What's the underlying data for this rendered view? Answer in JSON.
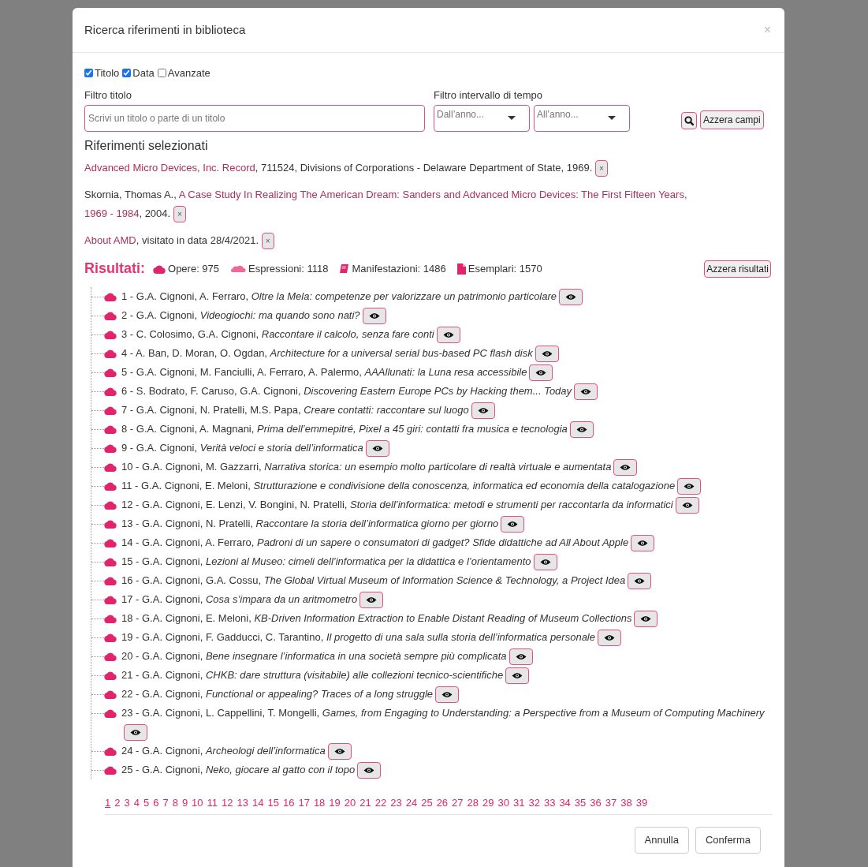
{
  "dialog": {
    "title": "Ricerca riferimenti in biblioteca",
    "close": "×"
  },
  "filters": [
    {
      "label": "Titolo",
      "checked": true
    },
    {
      "label": "Data",
      "checked": true
    },
    {
      "label": "Avanzate",
      "checked": false
    }
  ],
  "title_filter": {
    "label": "Filtro titolo",
    "placeholder": "Scrivi un titolo o parte di un titolo"
  },
  "time_filter": {
    "label": "Filtro intervallo di tempo",
    "from_placeholder": "Dall’anno...",
    "to_placeholder": "All’anno..."
  },
  "reset_fields": "Azzera campi",
  "selected_heading": "Riferimenti selezionati",
  "selected_refs": [
    {
      "segments": [
        {
          "kind": "link",
          "text": "Advanced Micro Devices, Inc. Record"
        },
        {
          "kind": "text",
          "text": ", 711524, Divisions of Corporations - Delaware Department of State, 1969."
        }
      ],
      "remove": "×"
    },
    {
      "segments": [
        {
          "kind": "text",
          "text": "Skornia, Thomas A.,"
        },
        {
          "kind": "link",
          "text": "A Case Study In Realizing The American Dream: Sanders and Advanced Micro Devices: The First Fifteen Years,"
        },
        {
          "kind": "link",
          "text": "1969 - 1984"
        },
        {
          "kind": "text",
          "text": ", 2004."
        }
      ],
      "remove": "×"
    },
    {
      "segments": [
        {
          "kind": "link",
          "text": "About AMD"
        },
        {
          "kind": "text",
          "text": ", visitato in data 28/4/2021."
        }
      ],
      "remove": "×"
    }
  ],
  "results": {
    "label": "Risultati:",
    "counts": [
      {
        "kind": "works",
        "text": "Opere: 975"
      },
      {
        "kind": "expressions",
        "text": "Espressioni: 1118"
      },
      {
        "kind": "manifestations",
        "text": "Manifestazioni: 1486"
      },
      {
        "kind": "items",
        "text": "Esemplari: 1570"
      }
    ],
    "reset": "Azzera risultati"
  },
  "result_rows": [
    {
      "prefix": "1 - G.A. Cignoni, A. Ferraro,",
      "title": "Oltre la Mela: competenze per valorizzare un patrimonio particolare"
    },
    {
      "prefix": "2 - G.A. Cignoni,",
      "title": "Videogiochi: ma quando sono nati?"
    },
    {
      "prefix": "3 - C. Colosimo, G.A. Cignoni,",
      "title": "Raccontare il calcolo, senza fare conti"
    },
    {
      "prefix": "4 - A. Ban, D. Moran, O. Ogdan,",
      "title": "Architecture for a universal serial bus-based PC flash disk"
    },
    {
      "prefix": "5 - G.A. Cignoni, M. Fanciulli, A. Ferraro, A. Palermo,",
      "title": "AAAllunati: la Luna resa accessibile"
    },
    {
      "prefix": "6 - S. Bodrato, F. Caruso, G.A. Cignoni,",
      "title": "Discovering Eastern Europe PCs by Hacking them... Today"
    },
    {
      "prefix": "7 - G.A. Cignoni, N. Pratelli, M.S. Papa,",
      "title": "Creare contatti: raccontare sul luogo"
    },
    {
      "prefix": "8 - G.A. Cignoni, A. Magnani,",
      "title": "Prima dell’emmepitré, Pixel a 45 giri: contatti fra musica e tecnologia"
    },
    {
      "prefix": "9 - G.A. Cignoni,",
      "title": "Verità veloci e storia dell’informatica"
    },
    {
      "prefix": "10 - G.A. Cignoni, M. Gazzarri,",
      "title": "Narrativa storica: un esempio molto particolare di realtà virtuale e aumentata"
    },
    {
      "prefix": "11 - G.A. Cignoni, E. Meloni,",
      "title": "Strutturazione e condivisione della conoscenza, informatica ed economia della catalogazione"
    },
    {
      "prefix": "12 - G.A. Cignoni, E. Lenzi, V. Bongini, N. Pratelli,",
      "title": "Storia dell’informatica: metodi e strumenti per raccontarla da informatici"
    },
    {
      "prefix": "13 - G.A. Cignoni, N. Pratelli,",
      "title": "Raccontare la storia dell’informatica giorno per giorno"
    },
    {
      "prefix": "14 - G.A. Cignoni, A. Ferraro,",
      "title": "Padroni di un sapere o consumatori di gadget? Sfide didattiche ad All About Apple"
    },
    {
      "prefix": "15 - G.A. Cignoni,",
      "title": "Lezioni al Museo: cimeli dell’informatica per la didattica e l’orientamento"
    },
    {
      "prefix": "16 - G.A. Cignoni, G.A. Cossu,",
      "title": "The Global Virtual Museum of Information Science & Technology, a Project Idea"
    },
    {
      "prefix": "17 - G.A. Cignoni,",
      "title": "Cosa s’impara da un aritmometro"
    },
    {
      "prefix": "18 - G.A. Cignoni, E. Meloni,",
      "title": "KB-Driven Information Extraction to Enable Distant Reading of Museum Collections"
    },
    {
      "prefix": "19 - G.A. Cignoni, F. Gadducci, C. Tarantino,",
      "title": "Il progetto di una sala sulla storia dell’informatica personale"
    },
    {
      "prefix": "20 - G.A. Cignoni,",
      "title": "Bene insegnare l’informatica in una società sempre più complicata"
    },
    {
      "prefix": "21 - G.A. Cignoni,",
      "title": "CHKB: dare struttura (visitabile) alle collezioni tecnico-scientifiche"
    },
    {
      "prefix": "22 - G.A. Cignoni,",
      "title": "Functional or appealing? Traces of a long struggle"
    },
    {
      "prefix": "23 - G.A. Cignoni, L. Cappellini, T. Mongelli,",
      "title": "Games, from Engaging to Understanding: a Perspective from a Museum of Computing Machinery"
    },
    {
      "prefix": "24 - G.A. Cignoni,",
      "title": "Archeologi dell’informatica"
    },
    {
      "prefix": "25 - G.A. Cignoni,",
      "title": "Neko, giocare al gatto con il topo"
    }
  ],
  "pages": [
    {
      "label": "1",
      "selected": true
    },
    {
      "label": "2",
      "selected": false
    },
    {
      "label": "3",
      "selected": false
    },
    {
      "label": "4",
      "selected": false
    },
    {
      "label": "5",
      "selected": false
    },
    {
      "label": "6",
      "selected": false
    },
    {
      "label": "7",
      "selected": false
    },
    {
      "label": "8",
      "selected": false
    },
    {
      "label": "9",
      "selected": false
    },
    {
      "label": "10",
      "selected": false
    },
    {
      "label": "11",
      "selected": false
    },
    {
      "label": "12",
      "selected": false
    },
    {
      "label": "13",
      "selected": false
    },
    {
      "label": "14",
      "selected": false
    },
    {
      "label": "15",
      "selected": false
    },
    {
      "label": "16",
      "selected": false
    },
    {
      "label": "17",
      "selected": false
    },
    {
      "label": "18",
      "selected": false
    },
    {
      "label": "19",
      "selected": false
    },
    {
      "label": "20",
      "selected": false
    },
    {
      "label": "21",
      "selected": false
    },
    {
      "label": "22",
      "selected": false
    },
    {
      "label": "23",
      "selected": false
    },
    {
      "label": "24",
      "selected": false
    },
    {
      "label": "25",
      "selected": false
    },
    {
      "label": "26",
      "selected": false
    },
    {
      "label": "27",
      "selected": false
    },
    {
      "label": "28",
      "selected": false
    },
    {
      "label": "29",
      "selected": false
    },
    {
      "label": "30",
      "selected": false
    },
    {
      "label": "31",
      "selected": false
    },
    {
      "label": "32",
      "selected": false
    },
    {
      "label": "33",
      "selected": false
    },
    {
      "label": "34",
      "selected": false
    },
    {
      "label": "35",
      "selected": false
    },
    {
      "label": "36",
      "selected": false
    },
    {
      "label": "37",
      "selected": false
    },
    {
      "label": "38",
      "selected": false
    },
    {
      "label": "39",
      "selected": false
    }
  ],
  "footer_buttons": [
    "Annulla",
    "Conferma"
  ]
}
